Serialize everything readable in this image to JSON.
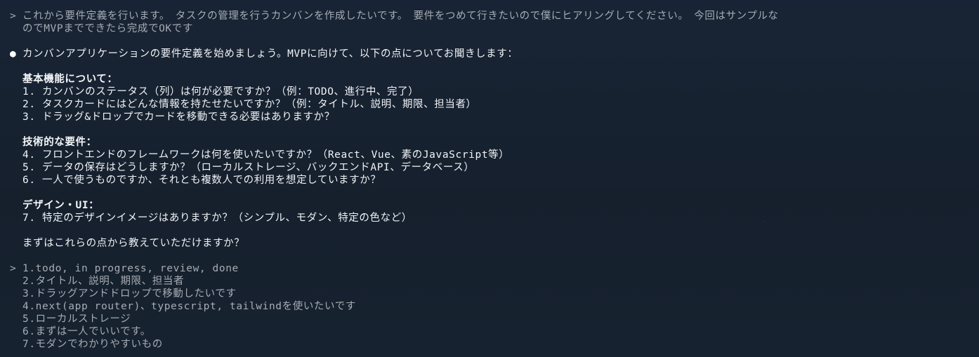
{
  "prompt_symbol": ">",
  "bullet_symbol": "●",
  "user_message_1": {
    "line1": "これから要件定義を行います。　タスクの管理を行うカンバンを作成したいです。　要件をつめて行きたいので僕にヒアリングしてください。　今回はサンプルな",
    "line2": "のでMVPまでできたら完成でOKです"
  },
  "assistant": {
    "intro": "カンバンアプリケーションの要件定義を始めましょう。MVPに向けて、以下の点についてお聞きします：",
    "sections": [
      {
        "heading": "基本機能について：",
        "items": [
          "1. カンバンのステータス（列）は何が必要ですか？（例：TODO、進行中、完了）",
          "2. タスクカードにはどんな情報を持たせたいですか？（例：タイトル、説明、期限、担当者）",
          "3. ドラッグ&ドロップでカードを移動できる必要はありますか？"
        ]
      },
      {
        "heading": "技術的な要件：",
        "items": [
          "4. フロントエンドのフレームワークは何を使いたいですか？（React、Vue、素のJavaScript等）",
          "5. データの保存はどうしますか？（ローカルストレージ、バックエンドAPI、データベース）",
          "6. 一人で使うものですか、それとも複数人での利用を想定していますか？"
        ]
      },
      {
        "heading": "デザイン・UI：",
        "items": [
          "7. 特定のデザインイメージはありますか？（シンプル、モダン、特定の色など）"
        ]
      }
    ],
    "closing": "まずはこれらの点から教えていただけますか？"
  },
  "user_message_2": {
    "lines": [
      "1.todo, in progress, review, done",
      "2.タイトル、説明、期限、担当者",
      "3.ドラッグアンドドロップで移動したいです",
      "4.next(app router)、typescript, tailwindを使いたいです",
      "5.ローカルストレージ",
      "6.まずは一人でいいです。",
      "7.モダンでわかりやすいもの"
    ]
  }
}
